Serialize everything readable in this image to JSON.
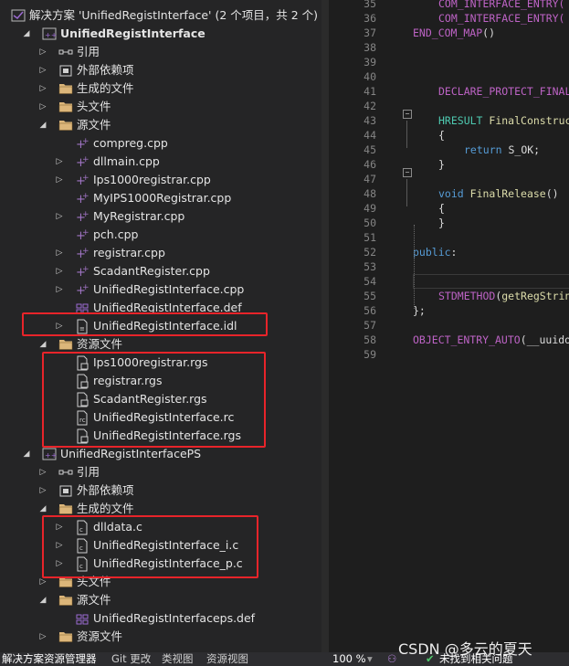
{
  "solution_explorer": {
    "solution_title": "解决方案 'UnifiedRegistInterface' (2 个项目，共 2 个)",
    "project1": {
      "name": "UnifiedRegistInterface",
      "references": "引用",
      "external_deps": "外部依赖项",
      "generated_files": "生成的文件",
      "header_files": "头文件",
      "source_files": "源文件",
      "sources": [
        "compreg.cpp",
        "dllmain.cpp",
        "Ips1000registrar.cpp",
        "MyIPS1000Registrar.cpp",
        "MyRegistrar.cpp",
        "pch.cpp",
        "registrar.cpp",
        "ScadantRegister.cpp",
        "UnifiedRegistInterface.cpp",
        "UnifiedRegistInterface.def",
        "UnifiedRegistInterface.idl"
      ],
      "resource_files": "资源文件",
      "resources": [
        "Ips1000registrar.rgs",
        "registrar.rgs",
        "ScadantRegister.rgs",
        "UnifiedRegistInterface.rc",
        "UnifiedRegistInterface.rgs"
      ]
    },
    "project2": {
      "name": "UnifiedRegistInterfacePS",
      "references": "引用",
      "external_deps": "外部依赖项",
      "generated_files": "生成的文件",
      "generated": [
        "dlldata.c",
        "UnifiedRegistInterface_i.c",
        "UnifiedRegistInterface_p.c"
      ],
      "header_files": "头文件",
      "source_files": "源文件",
      "sources": [
        "UnifiedRegistInterfaceps.def"
      ],
      "resource_files": "资源文件"
    }
  },
  "editor": {
    "lines": [
      {
        "n": "35",
        "t": "COM_INTERFACE_ENTRY("
      },
      {
        "n": "36",
        "t": "COM_INTERFACE_ENTRY("
      },
      {
        "n": "37",
        "t": "END_COM_MAP()"
      },
      {
        "n": "38",
        "t": ""
      },
      {
        "n": "39",
        "t": ""
      },
      {
        "n": "40",
        "t": ""
      },
      {
        "n": "41",
        "t": "DECLARE_PROTECT_FINAL"
      },
      {
        "n": "42",
        "t": ""
      },
      {
        "n": "43",
        "t": "HRESULT FinalConstruc"
      },
      {
        "n": "44",
        "t": "{"
      },
      {
        "n": "45",
        "t": "return S_OK;"
      },
      {
        "n": "46",
        "t": "}"
      },
      {
        "n": "47",
        "t": ""
      },
      {
        "n": "48",
        "t": "void FinalRelease()"
      },
      {
        "n": "49",
        "t": "{"
      },
      {
        "n": "50",
        "t": "}"
      },
      {
        "n": "51",
        "t": ""
      },
      {
        "n": "52",
        "t": "public:"
      },
      {
        "n": "53",
        "t": ""
      },
      {
        "n": "54",
        "t": ""
      },
      {
        "n": "55",
        "t": "STDMETHOD(getRegStrin"
      },
      {
        "n": "56",
        "t": "};"
      },
      {
        "n": "57",
        "t": ""
      },
      {
        "n": "58",
        "t": "OBJECT_ENTRY_AUTO(__uuido"
      },
      {
        "n": "59",
        "t": ""
      }
    ]
  },
  "bottom_tabs": [
    "解决方案资源管理器",
    "Git 更改",
    "类视图",
    "资源视图"
  ],
  "status": {
    "zoom": "100 %",
    "issues": "未找到相关问题"
  },
  "watermark": "CSDN @多云的夏天",
  "colors": {
    "highlight": "#e8242a",
    "folder": "#dcb67a",
    "cpp": "#9b6ad1"
  }
}
